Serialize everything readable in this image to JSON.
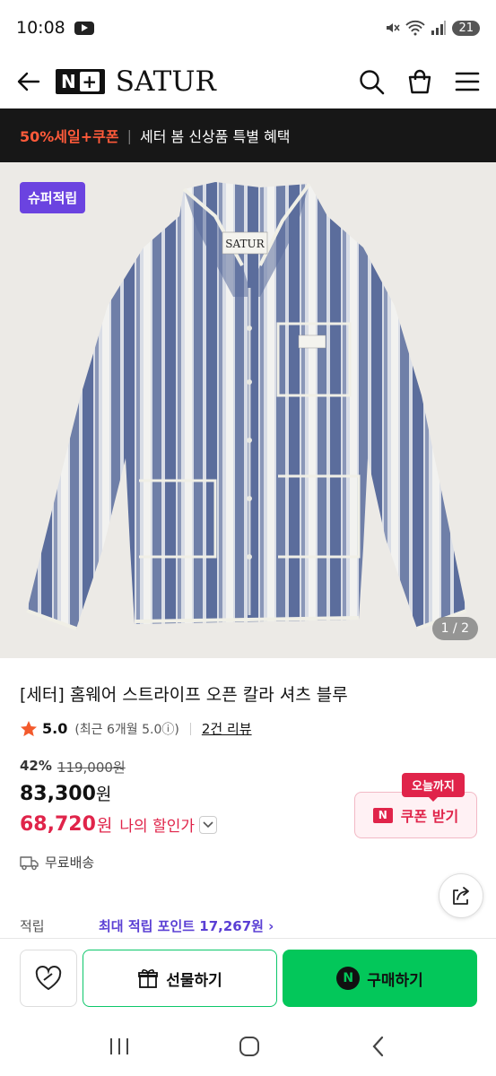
{
  "status_bar": {
    "time": "10:08",
    "battery": "21"
  },
  "header": {
    "naver_plus": "N",
    "brand": "SATUR"
  },
  "promo": {
    "highlight": "50%세일+쿠폰",
    "separator": "|",
    "text": "세터 봄 신상품 특별 혜택"
  },
  "gallery": {
    "badge": "슈퍼적립",
    "counter": "1 / 2",
    "garment_label": "SATUR"
  },
  "product": {
    "title": "[세터] 홈웨어 스트라이프 오픈 칼라 셔츠 블루",
    "rating_score": "5.0",
    "rating_period": "(최근 6개월 5.0ⓘ)",
    "review_count": "2건 리뷰",
    "discount_rate": "42%",
    "original_price": "119,000원",
    "sale_price": "83,300",
    "sale_price_unit": "원",
    "my_price": "68,720",
    "my_price_unit": "원",
    "my_price_label": "나의 할인가",
    "shipping": "무료배송",
    "points_label": "적립",
    "points_value": "최대 적립 포인트 17,267원 ›"
  },
  "coupon": {
    "tag": "오늘까지",
    "logo": "N",
    "label": "쿠폰 받기"
  },
  "bottom_bar": {
    "gift_label": "선물하기",
    "buy_logo": "N",
    "buy_label": "구매하기"
  },
  "colors": {
    "accent_green": "#03c75a",
    "sale_red": "#e0244a",
    "points_purple": "#5a3fd4",
    "badge_purple": "#6b43e0",
    "promo_orange": "#ff5a3a"
  },
  "icons": [
    "back-arrow-icon",
    "search-icon",
    "shopping-bag-icon",
    "menu-icon",
    "star-icon",
    "truck-icon",
    "share-icon",
    "heart-icon",
    "gift-icon",
    "chevron-down-icon"
  ]
}
